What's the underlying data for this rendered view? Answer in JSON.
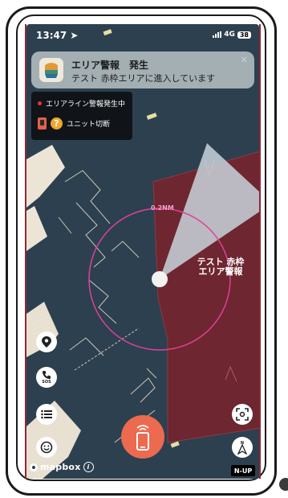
{
  "status_bar": {
    "time": "13:47",
    "network": "4G",
    "battery": "38"
  },
  "notification": {
    "title": "エリア警報　発生",
    "body": "テスト 赤枠エリアに進入しています",
    "icon": "app-logo-icon"
  },
  "alert_panel": {
    "status_text": "エリアライン警報発生中",
    "unit_text": "ユニット切断",
    "unit_icon": "device-icon",
    "question_icon": "question-icon"
  },
  "map": {
    "range_label": "0.2NM",
    "area_label": "テスト 赤枠エリア警報",
    "colors": {
      "water": "#2c4050",
      "alert_area": "#6e2630",
      "range_circle": "#e0409a",
      "sector": "#c9d4da"
    }
  },
  "controls": {
    "location_icon": "location-pin-icon",
    "sos_label": "SOS",
    "list_icon": "list-icon",
    "face_icon": "smiley-icon",
    "recenter_icon": "recenter-icon",
    "compass_icon": "compass-icon",
    "north_up_label": "N-UP",
    "main_action_icon": "phone-signal-icon"
  },
  "attribution": {
    "brand": "mapbox",
    "info": "i"
  }
}
